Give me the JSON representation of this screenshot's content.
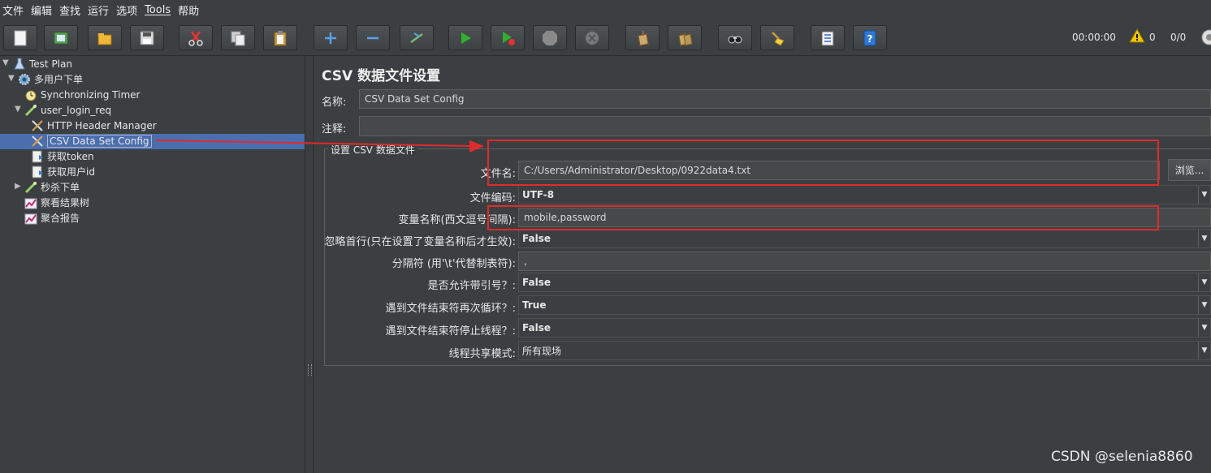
{
  "menubar": [
    "文件",
    "编辑",
    "查找",
    "运行",
    "选项",
    "Tools",
    "帮助"
  ],
  "toolbar": {
    "icons": [
      "new-icon",
      "templates-icon",
      "open-icon",
      "save-icon",
      "cut-icon",
      "copy-icon",
      "paste-icon",
      "expand-icon",
      "collapse-icon",
      "toggle-icon",
      "start-icon",
      "start-no-pause-icon",
      "stop-icon",
      "shutdown-icon",
      "clear-icon",
      "clear-all-icon",
      "search-icon",
      "reset-search-icon",
      "function-helper-icon",
      "help-icon"
    ],
    "timer": "00:00:00",
    "warnings": "0",
    "threads": "0/0"
  },
  "tree": [
    {
      "label": "Test Plan"
    },
    {
      "label": "多用户下单"
    },
    {
      "label": "Synchronizing Timer"
    },
    {
      "label": "user_login_req"
    },
    {
      "label": "HTTP Header Manager"
    },
    {
      "label": "CSV Data Set Config"
    },
    {
      "label": "获取token"
    },
    {
      "label": "获取用户id"
    },
    {
      "label": "秒杀下单"
    },
    {
      "label": "察看结果树"
    },
    {
      "label": "聚合报告"
    }
  ],
  "panel": {
    "title": "CSV 数据文件设置",
    "name_label": "名称:",
    "name_value": "CSV Data Set Config",
    "comment_label": "注释:",
    "comment_value": "",
    "group_title": "设置 CSV 数据文件",
    "filename_label": "文件名:",
    "filename_value": "C:/Users/Administrator/Desktop/0922data4.txt",
    "browse_label": "浏览...",
    "encoding_label": "文件编码:",
    "encoding_value": "UTF-8",
    "varnames_label": "变量名称(西文逗号间隔):",
    "varnames_value": "mobile,password",
    "ignore_first_label": "忽略首行(只在设置了变量名称后才生效):",
    "ignore_first_value": "False",
    "delimiter_label": "分隔符 (用'\\t'代替制表符):",
    "delimiter_value": ",",
    "quoted_label": "是否允许带引号？:",
    "quoted_value": "False",
    "recycle_label": "遇到文件结束符再次循环？:",
    "recycle_value": "True",
    "stop_thread_label": "遇到文件结束符停止线程？:",
    "stop_thread_value": "False",
    "share_mode_label": "线程共享模式:",
    "share_mode_value": "所有现场"
  },
  "watermark": "CSDN @selenia8860"
}
